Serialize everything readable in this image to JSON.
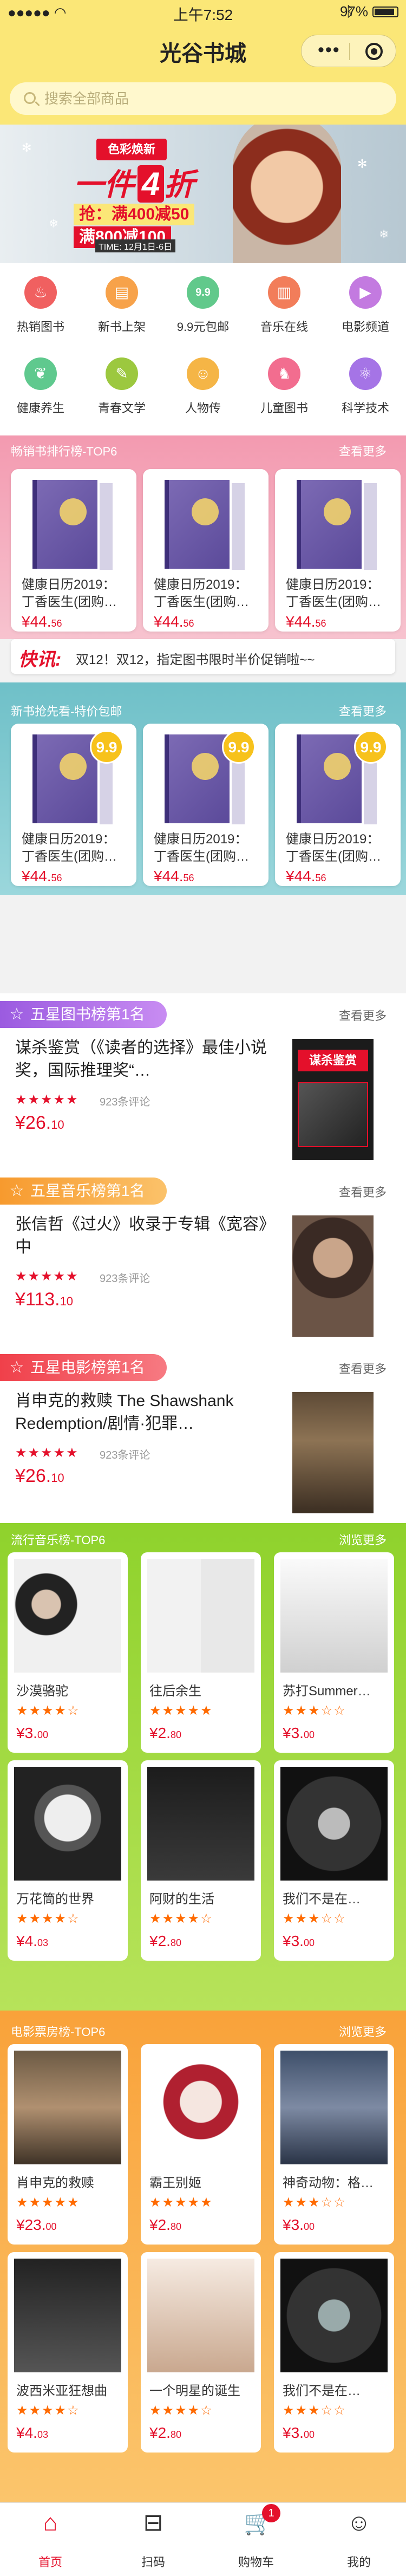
{
  "status": {
    "time": "上午7:52",
    "battery": "97%"
  },
  "app": {
    "title": "光谷书城",
    "search_placeholder": "搜索全部商品"
  },
  "banner": {
    "badge": "色彩焕新",
    "headline": "一件",
    "headline_num": "4",
    "headline_suffix": "折",
    "line1": "抢：满400减50",
    "line2": "满800减100",
    "date": "TIME: 12月1日-6日"
  },
  "categories": [
    {
      "label": "热销图书",
      "icon": "fire-icon",
      "color": "#f06060"
    },
    {
      "label": "新书上架",
      "icon": "book-icon",
      "color": "#f7a24a"
    },
    {
      "label": "9.9元包邮",
      "icon": "coin-icon",
      "color": "#61c98b"
    },
    {
      "label": "音乐在线",
      "icon": "bars-icon",
      "color": "#f27d5a"
    },
    {
      "label": "电影频道",
      "icon": "film-icon",
      "color": "#c37ae0"
    },
    {
      "label": "健康养生",
      "icon": "leaf-icon",
      "color": "#5fc98e"
    },
    {
      "label": "青春文学",
      "icon": "pen-icon",
      "color": "#9cc83f"
    },
    {
      "label": "人物传",
      "icon": "person-icon",
      "color": "#f5b546"
    },
    {
      "label": "儿童图书",
      "icon": "horse-icon",
      "color": "#f26d8f"
    },
    {
      "label": "科学技术",
      "icon": "atom-icon",
      "color": "#a574e6"
    }
  ],
  "bestsellers": {
    "title": "畅销书排行榜-TOP6",
    "more": "查看更多",
    "items": [
      {
        "name": "健康日历2019：丁香医生(团购…",
        "price_int": "¥44.",
        "price_dec": "56"
      },
      {
        "name": "健康日历2019：丁香医生(团购…",
        "price_int": "¥44.",
        "price_dec": "56"
      },
      {
        "name": "健康日历2019：丁香医生(团购…",
        "price_int": "¥44.",
        "price_dec": "56"
      }
    ]
  },
  "notice": {
    "tag": "快讯:",
    "message": "双12！双12，指定图书限时半价促销啦~~"
  },
  "new_books": {
    "title": "新书抢先看-特价包邮",
    "more": "查看更多",
    "tag": "9.9",
    "items": [
      {
        "name": "健康日历2019：丁香医生(团购…",
        "price_int": "¥44.",
        "price_dec": "56"
      },
      {
        "name": "健康日历2019：丁香医生(团购…",
        "price_int": "¥44.",
        "price_dec": "56"
      },
      {
        "name": "健康日历2019：丁香医生(团购…",
        "price_int": "¥44.",
        "price_dec": "56"
      }
    ]
  },
  "top_book": {
    "tab": "五星图书榜第1名",
    "more": "查看更多",
    "title": "谋杀鉴赏（《读者的选择》最佳小说奖，国际推理奖“…",
    "stars": "★★★★★",
    "reviews": "923条评论",
    "price_int": "¥26.",
    "price_dec": "10",
    "cover_text": "谋杀鉴赏"
  },
  "top_music": {
    "tab": "五星音乐榜第1名",
    "more": "查看更多",
    "title": "张信哲《过火》收录于专辑《宽容》中",
    "stars": "★★★★★",
    "reviews": "923条评论",
    "price_int": "¥113.",
    "price_dec": "10"
  },
  "top_movie": {
    "tab": "五星电影榜第1名",
    "more": "查看更多",
    "title": "肖申克的救赎 The Shawshank Redemption/剧情·犯罪…",
    "stars": "★★★★★",
    "reviews": "923条评论",
    "price_int": "¥26.",
    "price_dec": "10"
  },
  "music_chart": {
    "title": "流行音乐榜-TOP6",
    "more": "浏览更多",
    "items": [
      {
        "name": "沙漠骆驼",
        "stars": "★★★★☆",
        "price_int": "¥3.",
        "price_dec": "00"
      },
      {
        "name": "往后余生",
        "stars": "★★★★★",
        "price_int": "¥2.",
        "price_dec": "80"
      },
      {
        "name": "苏打Summer…",
        "stars": "★★★☆☆",
        "price_int": "¥3.",
        "price_dec": "00"
      },
      {
        "name": "万花筒的世界",
        "stars": "★★★★☆",
        "price_int": "¥4.",
        "price_dec": "03"
      },
      {
        "name": "阿财的生活",
        "stars": "★★★★☆",
        "price_int": "¥2.",
        "price_dec": "80"
      },
      {
        "name": "我们不是在…",
        "stars": "★★★☆☆",
        "price_int": "¥3.",
        "price_dec": "00"
      }
    ]
  },
  "movie_chart": {
    "title": "电影票房榜-TOP6",
    "more": "浏览更多",
    "items": [
      {
        "name": "肖申克的救赎",
        "stars": "★★★★★",
        "price_int": "¥23.",
        "price_dec": "00"
      },
      {
        "name": "霸王别姬",
        "stars": "★★★★★",
        "price_int": "¥2.",
        "price_dec": "80"
      },
      {
        "name": "神奇动物：格…",
        "stars": "★★★☆☆",
        "price_int": "¥3.",
        "price_dec": "00"
      },
      {
        "name": "波西米亚狂想曲",
        "stars": "★★★★☆",
        "price_int": "¥4.",
        "price_dec": "03"
      },
      {
        "name": "一个明星的诞生",
        "stars": "★★★★☆",
        "price_int": "¥2.",
        "price_dec": "80"
      },
      {
        "name": "我们不是在…",
        "stars": "★★★☆☆",
        "price_int": "¥3.",
        "price_dec": "00"
      }
    ]
  },
  "tabbar": [
    {
      "label": "首页",
      "icon": "home-icon",
      "active": true
    },
    {
      "label": "扫码",
      "icon": "scan-icon",
      "active": false
    },
    {
      "label": "购物车",
      "icon": "cart-icon",
      "active": false,
      "badge": "1"
    },
    {
      "label": "我的",
      "icon": "user-icon",
      "active": false
    }
  ],
  "colors": {
    "header": "#fbe777",
    "accent": "#e4102b",
    "bestseller_bg": "#f08aa2",
    "new_bg": "#7ec8cf",
    "music_bg": "#9ed63e",
    "movie_bg": "#fbb14a"
  }
}
